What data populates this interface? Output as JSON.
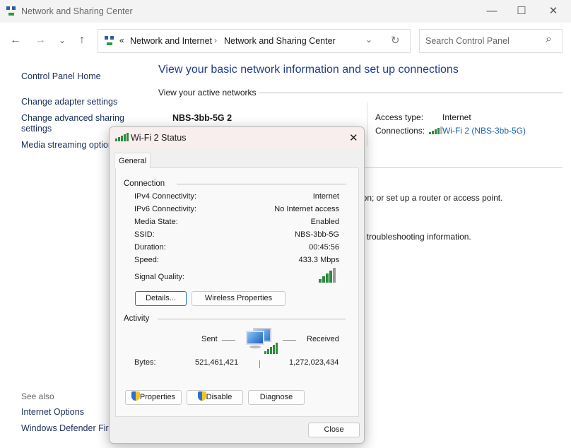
{
  "window": {
    "title": "Network and Sharing Center",
    "minimize": "—",
    "maximize": "☐",
    "close": "✕"
  },
  "nav": {
    "back": "←",
    "forward": "→",
    "recent": "⌄",
    "up": "↑"
  },
  "address": {
    "chevrons": "«",
    "crumbs": [
      "Network and Internet",
      "Network and Sharing Center"
    ],
    "sep": "›",
    "dropdown": "⌄",
    "refresh": "↻"
  },
  "search": {
    "placeholder": "Search Control Panel",
    "icon": "⌕"
  },
  "sidebar": {
    "items": [
      "Control Panel Home",
      "Change adapter settings",
      "Change advanced sharing settings",
      "Media streaming options"
    ],
    "see_also": "See also",
    "see_also_items": [
      "Internet Options",
      "Windows Defender Firewall"
    ]
  },
  "main": {
    "heading": "View your basic network information and set up connections",
    "active_networks": "View your active networks",
    "network_name": "NBS-3bb-5G 2",
    "access_type_label": "Access type:",
    "access_type": "Internet",
    "connections_label": "Connections:",
    "connection": "Wi-Fi 2 (NBS-3bb-5G)",
    "partial_text_1": "ion; or set up a router or access point.",
    "partial_text_2": "t troubleshooting information."
  },
  "dialog": {
    "title": "Wi-Fi 2 Status",
    "close": "✕",
    "tab": "General",
    "connection_group": "Connection",
    "rows": [
      {
        "label": "IPv4 Connectivity:",
        "value": "Internet"
      },
      {
        "label": "IPv6 Connectivity:",
        "value": "No Internet access"
      },
      {
        "label": "Media State:",
        "value": "Enabled"
      },
      {
        "label": "SSID:",
        "value": "NBS-3bb-5G"
      },
      {
        "label": "Duration:",
        "value": "00:45:56"
      },
      {
        "label": "Speed:",
        "value": "433.3 Mbps"
      }
    ],
    "signal_label": "Signal Quality:",
    "signal_bars": 5,
    "signal_max": 5,
    "details_btn": "Details...",
    "wireless_btn": "Wireless Properties",
    "activity_group": "Activity",
    "sent": "Sent",
    "received": "Received",
    "bytes_label": "Bytes:",
    "bytes_sent": "521,461,421",
    "bytes_received": "1,272,023,434",
    "properties_btn": "Properties",
    "disable_btn": "Disable",
    "diagnose_btn": "Diagnose",
    "close_btn": "Close"
  },
  "colors": {
    "link": "#1b64b0",
    "heading": "#1f3d8f",
    "signal": "#2e8b3e"
  }
}
